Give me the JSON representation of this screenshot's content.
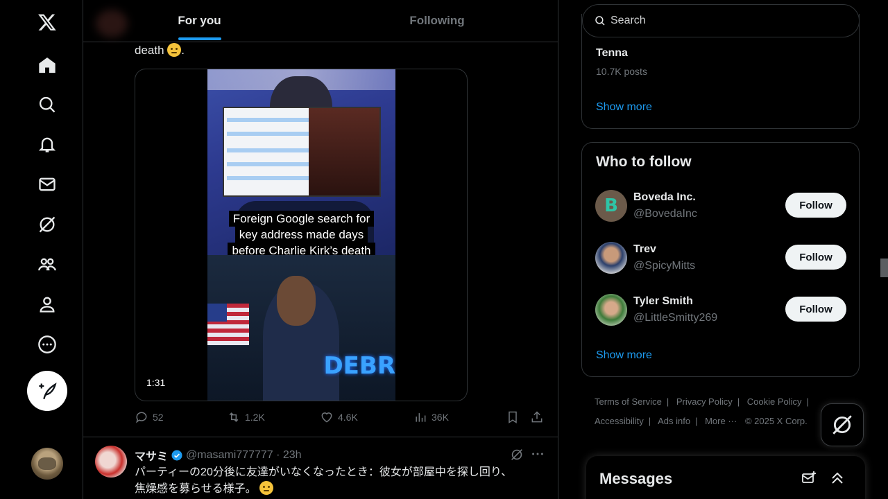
{
  "nav": {
    "items": [
      "x-logo",
      "home",
      "explore",
      "notifications",
      "messages",
      "grok",
      "communities",
      "profile",
      "more"
    ],
    "post_button": "compose"
  },
  "tabs": [
    {
      "label": "For you",
      "active": true
    },
    {
      "label": "Following",
      "active": false
    }
  ],
  "tweet1": {
    "text_tail": "death",
    "text_end": ".",
    "video": {
      "caption": [
        "Foreign Google search for",
        "key address made days",
        "before Charlie Kirk’s death"
      ],
      "duration": "1:31"
    },
    "stats": {
      "replies": "52",
      "reposts": "1.2K",
      "likes": "4.6K",
      "views": "36K"
    }
  },
  "tweet2": {
    "name": "マサミ",
    "handle": "@masami777777",
    "time": "23h",
    "text_line1": "パーティーの20分後に友達がいなくなったとき：彼女が部屋中を探し回り、",
    "text_line2": "焦燥感を募らせる様子。"
  },
  "search": {
    "placeholder": "Search"
  },
  "trending": {
    "name": "Tenna",
    "count": "10.7K posts",
    "show_more": "Show more"
  },
  "who_to_follow": {
    "title": "Who to follow",
    "users": [
      {
        "name": "Boveda Inc.",
        "handle": "@BovedaInc",
        "button": "Follow"
      },
      {
        "name": "Trev",
        "handle": "@SpicyMitts",
        "button": "Follow"
      },
      {
        "name": "Tyler Smith",
        "handle": "@LittleSmitty269",
        "button": "Follow"
      }
    ],
    "show_more": "Show more"
  },
  "footer": {
    "terms": "Terms of Service",
    "privacy": "Privacy Policy",
    "cookie": "Cookie Policy",
    "accessibility": "Accessibility",
    "ads": "Ads info",
    "more": "More ···",
    "copyright": "© 2025 X Corp."
  },
  "messages_drawer": {
    "title": "Messages"
  },
  "colors": {
    "accent": "#1d9bf0",
    "background": "#000000",
    "border": "#2f3336",
    "muted": "#71767b"
  }
}
